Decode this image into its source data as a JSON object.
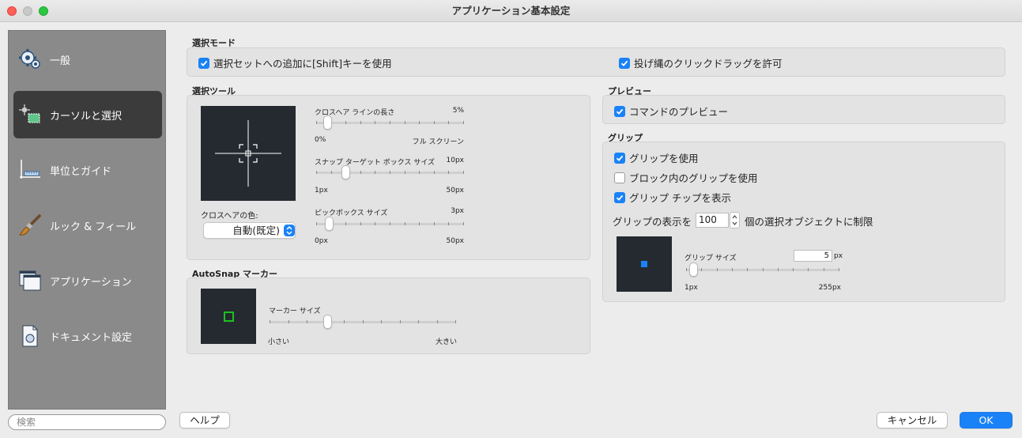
{
  "window": {
    "title": "アプリケーション基本設定"
  },
  "sidebar": {
    "items": [
      {
        "label": "一般",
        "icon": "gear-icon"
      },
      {
        "label": "カーソルと選択",
        "icon": "cursor-select-icon"
      },
      {
        "label": "単位とガイド",
        "icon": "ruler-icon"
      },
      {
        "label": "ルック & フィール",
        "icon": "paintbrush-icon"
      },
      {
        "label": "アプリケーション",
        "icon": "windows-icon"
      },
      {
        "label": "ドキュメント設定",
        "icon": "document-icon"
      }
    ],
    "search_placeholder": "検索"
  },
  "selection_mode": {
    "label": "選択モード",
    "shift_add": {
      "label": "選択セットへの追加に[Shift]キーを使用",
      "checked": true
    },
    "lasso": {
      "label": "投げ縄のクリックドラッグを許可",
      "checked": true
    }
  },
  "selection_tool": {
    "label": "選択ツール",
    "crosshair_color_label": "クロスヘアの色:",
    "crosshair_color_value": "自動(既定)",
    "crosshair_length": {
      "label": "クロスヘア ラインの長さ",
      "value": "5%",
      "min": "0%",
      "max": "フル スクリーン",
      "position": 0.05
    },
    "snap_box": {
      "label": "スナップ ターゲット ボックス サイズ",
      "value": "10px",
      "min": "1px",
      "max": "50px",
      "position": 0.18
    },
    "pickbox": {
      "label": "ピックボックス サイズ",
      "value": "3px",
      "min": "0px",
      "max": "50px",
      "position": 0.06
    }
  },
  "autosnap": {
    "label": "AutoSnap マーカー",
    "marker_size": {
      "label": "マーカー サイズ",
      "min": "小さい",
      "max": "大きい",
      "position": 0.3
    }
  },
  "preview": {
    "label": "プレビュー",
    "command_preview": {
      "label": "コマンドのプレビュー",
      "checked": true
    }
  },
  "grip": {
    "label": "グリップ",
    "use_grips": {
      "label": "グリップを使用",
      "checked": true
    },
    "grips_in_blocks": {
      "label": "ブロック内のグリップを使用",
      "checked": false
    },
    "grip_tips": {
      "label": "グリップ チップを表示",
      "checked": true
    },
    "limit_prefix": "グリップの表示を",
    "limit_value": "100",
    "limit_suffix": "個の選択オブジェクトに制限",
    "grip_size": {
      "label": "グリップ サイズ",
      "value": "5",
      "unit": "px",
      "min": "1px",
      "max": "255px",
      "position": 0.02
    }
  },
  "buttons": {
    "help": "ヘルプ",
    "cancel": "キャンセル",
    "ok": "OK"
  },
  "colors": {
    "accent": "#1a82f7",
    "preview_bg": "#252a31",
    "autosnap_marker": "#1fc01f",
    "grip_square": "#1a82f7"
  }
}
